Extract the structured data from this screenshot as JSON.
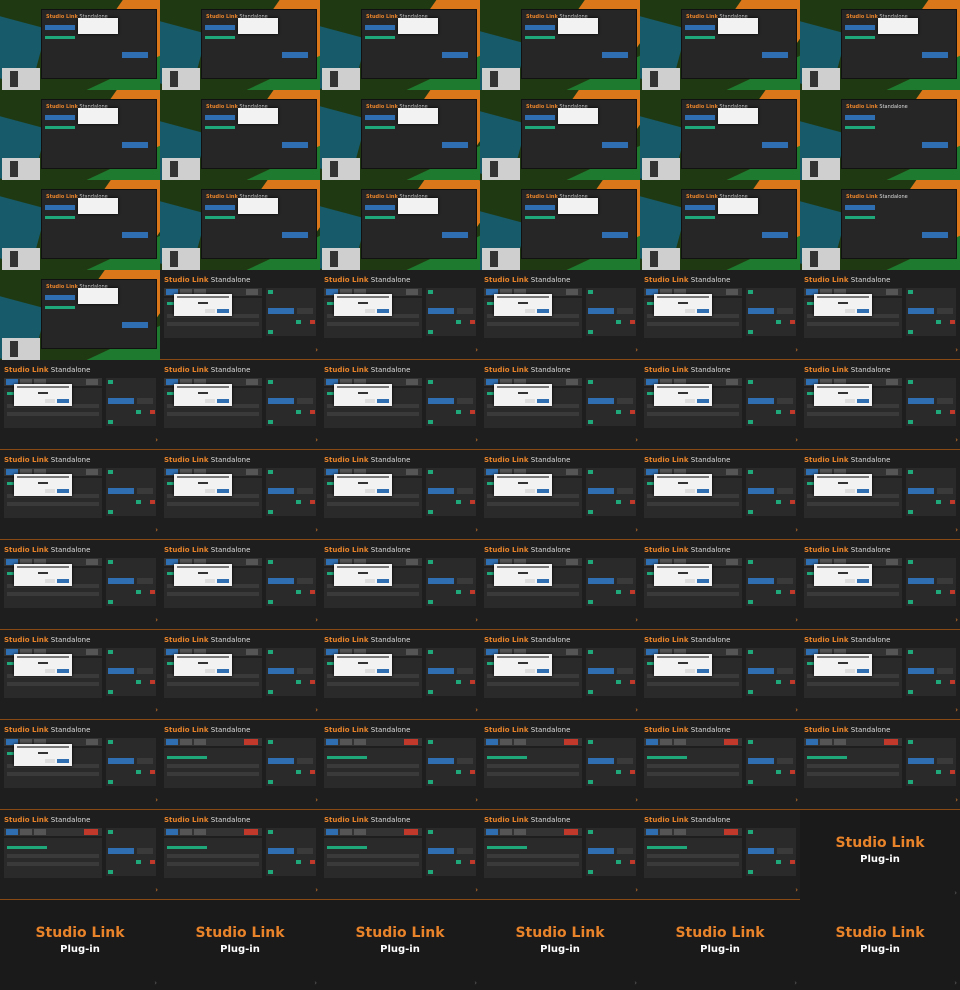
{
  "grid": {
    "columns": 6,
    "rows": 11
  },
  "brand": {
    "name": "Studio Link",
    "standalone_label": "Standalone",
    "plugin_label": "Plug-in",
    "accent_color": "#e8832a",
    "call_color": "#2f6fb1",
    "ok_color": "#1fa97a",
    "error_color": "#c0392b"
  },
  "frames": [
    "wallpaper-dialog",
    "wallpaper-dialog",
    "wallpaper-dialog",
    "wallpaper-dialog",
    "wallpaper-dialog",
    "wallpaper-dialog",
    "wallpaper-dialog",
    "wallpaper-dialog",
    "wallpaper-dialog",
    "wallpaper-dialog",
    "wallpaper-dialog",
    "wallpaper-blank",
    "wallpaper-dialog",
    "wallpaper-dialog",
    "wallpaper-dialog",
    "wallpaper-dialog",
    "wallpaper-dialog",
    "wallpaper-blank",
    "wallpaper-dialog",
    "app-dialog",
    "app-dialog",
    "app-dialog",
    "app-dialog",
    "app-dialog",
    "app-dialog",
    "app-dialog",
    "app-dialog",
    "app-dialog",
    "app-dialog",
    "app-dialog",
    "app-dialog",
    "app-dialog",
    "app-dialog",
    "app-dialog",
    "app-dialog",
    "app-dialog",
    "app-dialog",
    "app-dialog",
    "app-dialog",
    "app-dialog",
    "app-dialog",
    "app-dialog",
    "app-dialog",
    "app-dialog",
    "app-dialog",
    "app-dialog",
    "app-dialog",
    "app-dialog",
    "app-dialog",
    "app-call",
    "app-call",
    "app-call",
    "app-call",
    "app-call",
    "app-call",
    "app-call",
    "app-call",
    "app-call",
    "app-call",
    "splash",
    "splash",
    "splash",
    "splash",
    "splash",
    "splash",
    "splash"
  ]
}
